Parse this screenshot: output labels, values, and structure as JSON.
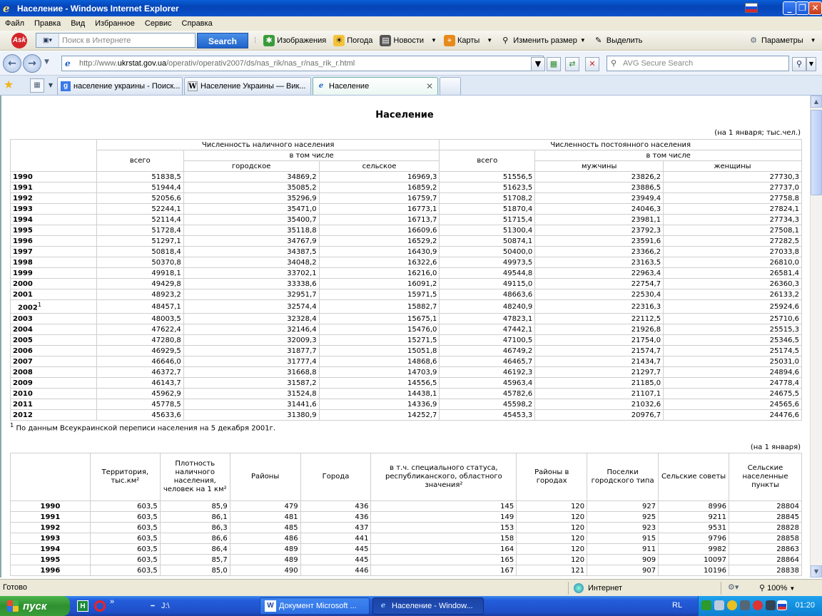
{
  "window": {
    "title": "Население - Windows Internet Explorer"
  },
  "menu": [
    "Файл",
    "Правка",
    "Вид",
    "Избранное",
    "Сервис",
    "Справка"
  ],
  "ask_toolbar": {
    "search_placeholder": "Поиск в Интернете",
    "search_button": "Search",
    "items": [
      "Изображения",
      "Погода",
      "Новости",
      "Карты",
      "Изменить размер",
      "Выделить"
    ],
    "settings": "Параметры"
  },
  "address": {
    "prefix": "http://www.",
    "domain": "ukrstat.gov.ua",
    "path": "/operativ/operativ2007/ds/nas_rik/nas_r/nas_rik_r.html",
    "avg_placeholder": "AVG Secure Search"
  },
  "tabs": [
    {
      "label": "население украины - Поиск..."
    },
    {
      "label": "Население Украины — Вик..."
    },
    {
      "label": "Население"
    }
  ],
  "page": {
    "title": "Население",
    "note1": "(на 1 января; тыс.чел.)",
    "table1": {
      "h_present": "Численность наличного населения",
      "h_permanent": "Численность постоянного населения",
      "h_total": "всего",
      "h_incl": "в том числе",
      "h_urban": "городское",
      "h_rural": "сельское",
      "h_men": "мужчины",
      "h_women": "женщины",
      "rows": [
        [
          "1990",
          "51838,5",
          "34869,2",
          "16969,3",
          "51556,5",
          "23826,2",
          "27730,3"
        ],
        [
          "1991",
          "51944,4",
          "35085,2",
          "16859,2",
          "51623,5",
          "23886,5",
          "27737,0"
        ],
        [
          "1992",
          "52056,6",
          "35296,9",
          "16759,7",
          "51708,2",
          "23949,4",
          "27758,8"
        ],
        [
          "1993",
          "52244,1",
          "35471,0",
          "16773,1",
          "51870,4",
          "24046,3",
          "27824,1"
        ],
        [
          "1994",
          "52114,4",
          "35400,7",
          "16713,7",
          "51715,4",
          "23981,1",
          "27734,3"
        ],
        [
          "1995",
          "51728,4",
          "35118,8",
          "16609,6",
          "51300,4",
          "23792,3",
          "27508,1"
        ],
        [
          "1996",
          "51297,1",
          "34767,9",
          "16529,2",
          "50874,1",
          "23591,6",
          "27282,5"
        ],
        [
          "1997",
          "50818,4",
          "34387,5",
          "16430,9",
          "50400,0",
          "23366,2",
          "27033,8"
        ],
        [
          "1998",
          "50370,8",
          "34048,2",
          "16322,6",
          "49973,5",
          "23163,5",
          "26810,0"
        ],
        [
          "1999",
          "49918,1",
          "33702,1",
          "16216,0",
          "49544,8",
          "22963,4",
          "26581,4"
        ],
        [
          "2000",
          "49429,8",
          "33338,6",
          "16091,2",
          "49115,0",
          "22754,7",
          "26360,3"
        ],
        [
          "2001",
          "48923,2",
          "32951,7",
          "15971,5",
          "48663,6",
          "22530,4",
          "26133,2"
        ],
        [
          "2002",
          "48457,1",
          "32574,4",
          "15882,7",
          "48240,9",
          "22316,3",
          "25924,6"
        ],
        [
          "2003",
          "48003,5",
          "32328,4",
          "15675,1",
          "47823,1",
          "22112,5",
          "25710,6"
        ],
        [
          "2004",
          "47622,4",
          "32146,4",
          "15476,0",
          "47442,1",
          "21926,8",
          "25515,3"
        ],
        [
          "2005",
          "47280,8",
          "32009,3",
          "15271,5",
          "47100,5",
          "21754,0",
          "25346,5"
        ],
        [
          "2006",
          "46929,5",
          "31877,7",
          "15051,8",
          "46749,2",
          "21574,7",
          "25174,5"
        ],
        [
          "2007",
          "46646,0",
          "31777,4",
          "14868,6",
          "46465,7",
          "21434,7",
          "25031,0"
        ],
        [
          "2008",
          "46372,7",
          "31668,8",
          "14703,9",
          "46192,3",
          "21297,7",
          "24894,6"
        ],
        [
          "2009",
          "46143,7",
          "31587,2",
          "14556,5",
          "45963,4",
          "21185,0",
          "24778,4"
        ],
        [
          "2010",
          "45962,9",
          "31524,8",
          "14438,1",
          "45782,6",
          "21107,1",
          "24675,5"
        ],
        [
          "2011",
          "45778,5",
          "31441,6",
          "14336,9",
          "45598,2",
          "21032,6",
          "24565,6"
        ],
        [
          "2012",
          "45633,6",
          "31380,9",
          "14252,7",
          "45453,3",
          "20976,7",
          "24476,6"
        ]
      ],
      "footnote_mark": "1",
      "footnote": "По данным Всеукраинской переписи населения на 5 декабря 2001г."
    },
    "note2": "(на 1 января)",
    "table2": {
      "headers": [
        "Территория, тыс.км²",
        "Плотность наличного населения, человек на 1 км²",
        "Районы",
        "Города",
        "в т.ч. специального статуса, республиканского, областного значения²",
        "Районы в городах",
        "Поселки городского типа",
        "Сельские советы",
        "Сельские населенные пункты"
      ],
      "rows": [
        [
          "1990",
          "603,5",
          "85,9",
          "479",
          "436",
          "145",
          "120",
          "927",
          "8996",
          "28804"
        ],
        [
          "1991",
          "603,5",
          "86,1",
          "481",
          "436",
          "149",
          "120",
          "925",
          "9211",
          "28845"
        ],
        [
          "1992",
          "603,5",
          "86,3",
          "485",
          "437",
          "153",
          "120",
          "923",
          "9531",
          "28828"
        ],
        [
          "1993",
          "603,5",
          "86,6",
          "486",
          "441",
          "158",
          "120",
          "915",
          "9796",
          "28858"
        ],
        [
          "1994",
          "603,5",
          "86,4",
          "489",
          "445",
          "164",
          "120",
          "911",
          "9982",
          "28863"
        ],
        [
          "1995",
          "603,5",
          "85,7",
          "489",
          "445",
          "165",
          "120",
          "909",
          "10097",
          "28864"
        ],
        [
          "1996",
          "603,5",
          "85,0",
          "490",
          "446",
          "167",
          "121",
          "907",
          "10196",
          "28838"
        ]
      ]
    }
  },
  "status": {
    "ready": "Готово",
    "zone": "Интернет",
    "zoom": "100%"
  },
  "taskbar": {
    "start": "пуск",
    "j_drive": "J:\\",
    "task1": "Документ Microsoft ...",
    "task2": "Население - Window...",
    "lang": "RL",
    "clock": "01:20"
  }
}
